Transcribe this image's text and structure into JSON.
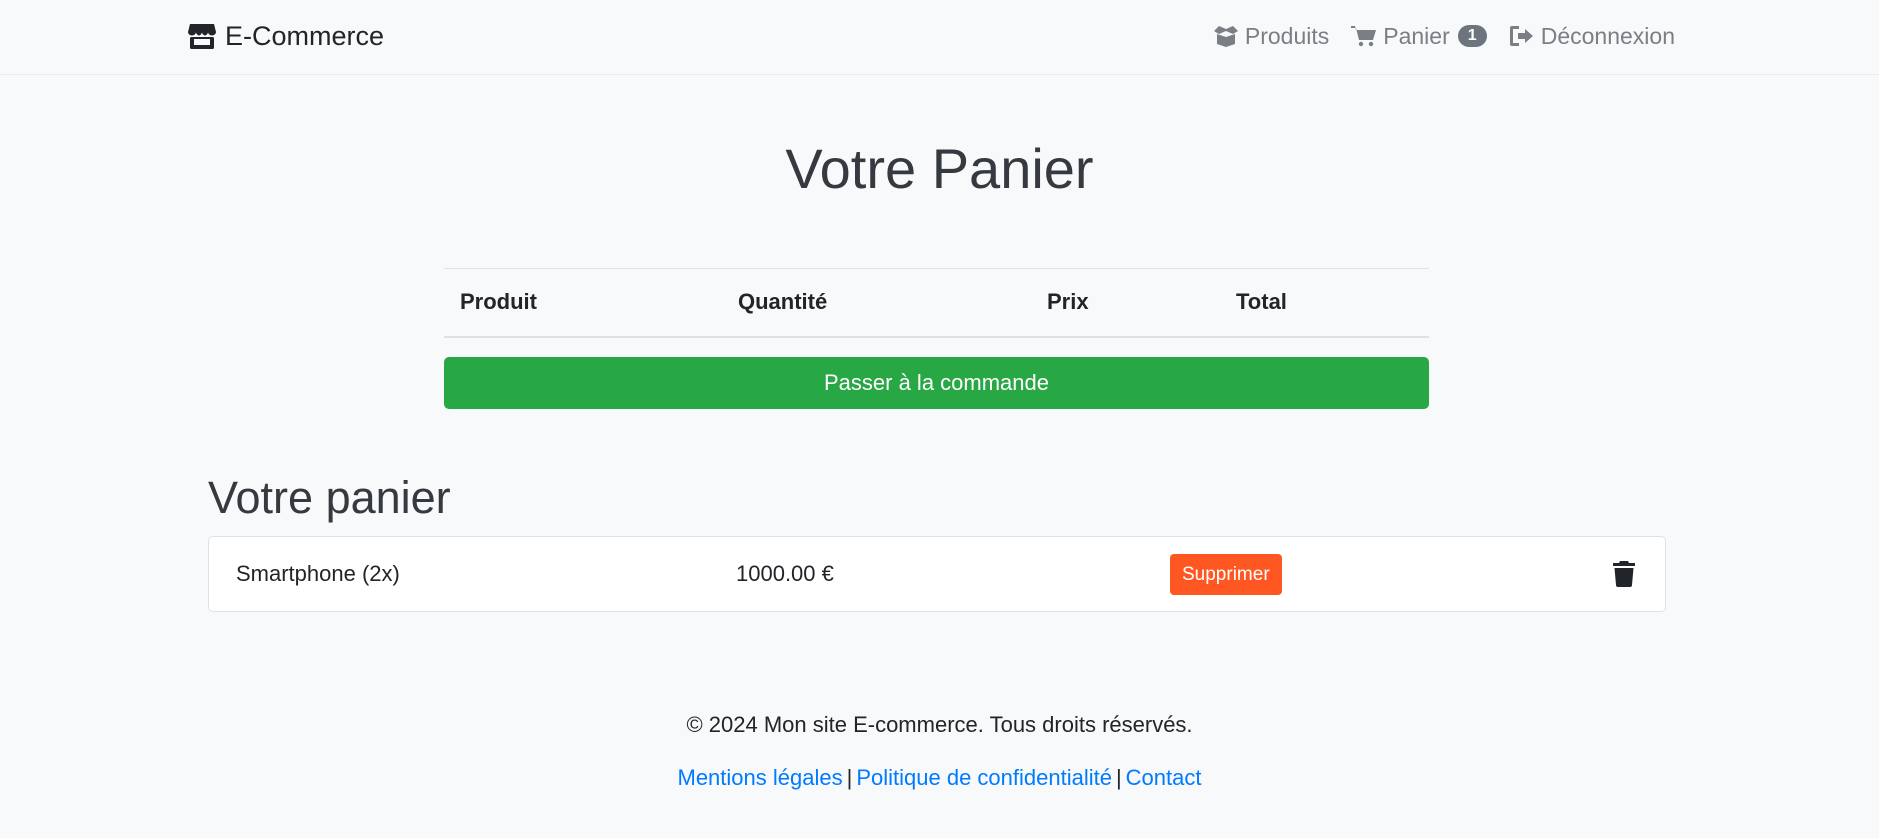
{
  "navbar": {
    "brand": "E-Commerce",
    "brand_icon": "store-icon",
    "links": [
      {
        "label": "Produits",
        "icon": "box-icon"
      },
      {
        "label": "Panier",
        "icon": "cart-icon",
        "badge": "1"
      },
      {
        "label": "Déconnexion",
        "icon": "sign-out-icon"
      }
    ]
  },
  "main": {
    "title": "Votre Panier",
    "table": {
      "headers": [
        "Produit",
        "Quantité",
        "Prix",
        "Total"
      ]
    },
    "checkout_label": "Passer à la commande"
  },
  "cart": {
    "title": "Votre panier",
    "items": [
      {
        "name": "Smartphone (2x)",
        "price": "1000.00 €",
        "remove_label": "Supprimer",
        "trash_icon": "trash-icon"
      }
    ]
  },
  "footer": {
    "copyright": "© 2024 Mon site E-commerce. Tous droits réservés.",
    "links": [
      "Mentions légales",
      "Politique de confidentialité",
      "Contact"
    ],
    "separator": "|"
  },
  "colors": {
    "background": "#f8f9fa",
    "checkout": "#28a745",
    "remove": "#ff5722",
    "link": "#007bff",
    "badge": "#6c757d"
  }
}
